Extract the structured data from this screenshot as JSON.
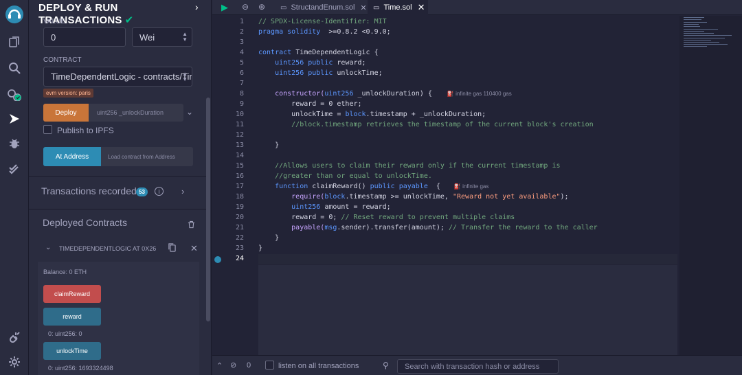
{
  "sidebar_panel": {
    "title": "DEPLOY & RUN TRANSACTIONS",
    "value_label": "VALUE",
    "value": "0",
    "unit": "Wei",
    "contract_label": "CONTRACT",
    "contract": "TimeDependentLogic - contracts/Tim",
    "evm_badge": "evm version: paris",
    "deploy_label": "Deploy",
    "deploy_arg_placeholder": "uint256 _unlockDuration",
    "publish_label": "Publish to IPFS",
    "at_address_label": "At Address",
    "load_contract_placeholder": "Load contract from Address",
    "transactions_label": "Transactions recorded",
    "transactions_count": "53",
    "deployed_label": "Deployed Contracts",
    "instance_name": "TIMEDEPENDENTLOGIC AT 0X26",
    "balance": "Balance: 0 ETH",
    "functions": [
      {
        "label": "claimReward",
        "output": ""
      },
      {
        "label": "reward",
        "output": "0: uint256: 0"
      },
      {
        "label": "unlockTime",
        "output": "0: uint256: 1693324498"
      }
    ]
  },
  "tabs": [
    {
      "label": "StructandEnum.sol",
      "active": false
    },
    {
      "label": "Time.sol",
      "active": true
    }
  ],
  "editor": {
    "current_line": 24,
    "gas_hints": {
      "constructor": "infinite gas 110400 gas",
      "claim": "infinite gas"
    }
  },
  "code": {
    "l1": "// SPDX-License-Identifier: MIT",
    "l2a": "pragma solidity",
    "l2b": "  >=0.8.2 <0.9.0;",
    "l4a": "contract",
    "l4b": " TimeDependentLogic {",
    "l5a": "    uint256 public",
    "l5b": " reward;",
    "l6a": "    uint256 public",
    "l6b": " unlockTime;",
    "l8a": "    constructor(",
    "l8b": "uint256",
    "l8c": " _unlockDuration) {",
    "l9": "        reward = 0 ether;",
    "l10a": "        unlockTime = ",
    "l10b": "block",
    "l10c": ".timestamp + _unlockDuration;",
    "l11": "        //block.timestamp retrieves the timestamp of the current block's creation",
    "l13": "    }",
    "l15": "    //Allows users to claim their reward only if the current timestamp is",
    "l16": "    //greater than or equal to unlockTime.",
    "l17a": "    function",
    "l17b": " claimReward() ",
    "l17c": "public payable",
    "l17d": "  {",
    "l18a": "        require(",
    "l18b": "block",
    "l18c": ".timestamp >= unlockTime, ",
    "l18d": "\"Reward not yet available\"",
    "l18e": ");",
    "l19a": "        uint256",
    "l19b": " amount = reward;",
    "l20a": "        reward = 0; ",
    "l20b": "// Reset reward to prevent multiple claims",
    "l21a": "        payable(",
    "l21b": "msg",
    "l21c": ".sender).transfer(amount); ",
    "l21d": "// Transfer the reward to the caller",
    "l22": "    }",
    "l23": "}"
  },
  "line_numbers": [
    "1",
    "2",
    "3",
    "4",
    "5",
    "6",
    "7",
    "8",
    "9",
    "10",
    "11",
    "12",
    "13",
    "14",
    "15",
    "16",
    "17",
    "18",
    "19",
    "20",
    "21",
    "22",
    "23",
    "24"
  ],
  "terminal": {
    "count": "0",
    "listen_label": "listen on all transactions",
    "search_placeholder": "Search with transaction hash or address"
  }
}
